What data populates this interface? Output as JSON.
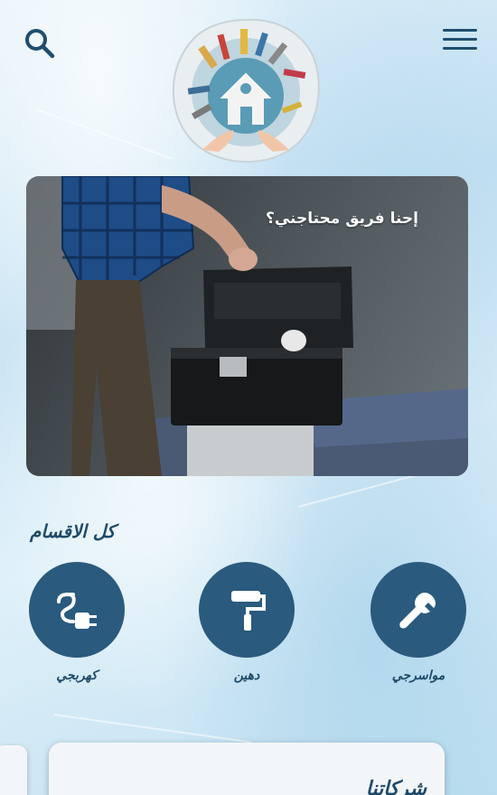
{
  "header": {
    "search_icon": "search-icon",
    "menu_icon": "hamburger-menu-icon",
    "logo_icon": "handyman-house-tools-logo"
  },
  "hero": {
    "caption": "إحنا فريق محتاجني؟"
  },
  "categories": {
    "title": "كل الاقسام",
    "items": [
      {
        "label": "مواسرجي",
        "icon": "wrench-icon"
      },
      {
        "label": "دهين",
        "icon": "paint-roller-icon"
      },
      {
        "label": "كهربجي",
        "icon": "electric-plug-icon"
      }
    ]
  },
  "bottom_card": {
    "title": "شركاتنا"
  },
  "colors": {
    "accent": "#2a5a7d",
    "text": "#1e4a69",
    "background": "#d6ebf7"
  }
}
